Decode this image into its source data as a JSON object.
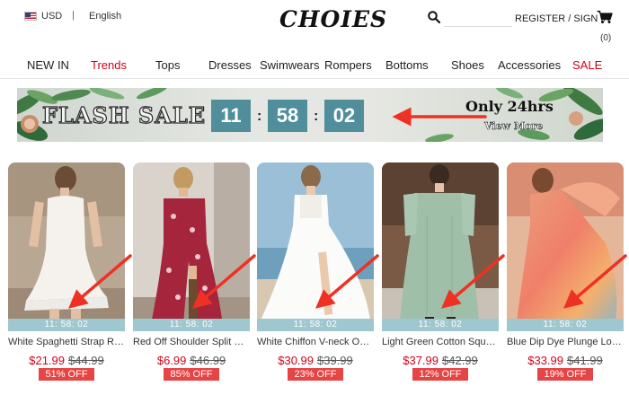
{
  "header": {
    "currency": "USD",
    "separator": "|",
    "language": "English",
    "logo": "CHOIES",
    "search": {
      "value": "",
      "placeholder": ""
    },
    "register": "REGISTER",
    "slash": "/",
    "signin": "SIGN IN",
    "cart_count": "(0)"
  },
  "nav": [
    {
      "label": "NEW IN",
      "color": "#222222"
    },
    {
      "label": "Trends",
      "color": "#d0021b"
    },
    {
      "label": "Tops",
      "color": "#222222"
    },
    {
      "label": "Dresses",
      "color": "#222222"
    },
    {
      "label": "Swimwears",
      "color": "#222222"
    },
    {
      "label": "Rompers",
      "color": "#222222"
    },
    {
      "label": "Bottoms",
      "color": "#222222"
    },
    {
      "label": "Shoes",
      "color": "#222222"
    },
    {
      "label": "Accessories",
      "color": "#222222"
    },
    {
      "label": "SALE",
      "color": "#d0021b"
    }
  ],
  "banner": {
    "title": "FLASH SALE",
    "hours": "11",
    "minutes": "58",
    "seconds": "02",
    "colon": ":",
    "tagline": "Only 24hrs",
    "cta": "View More",
    "box_color": "#4f8e9a"
  },
  "products": [
    {
      "name": "White Spaghetti Strap Ruffle Hem Bodycon Dress",
      "timer": "11: 58: 02",
      "price": "$21.99",
      "old_price": "$44.99",
      "discount": "51% OFF"
    },
    {
      "name": "Red Off Shoulder Split Side Floral Maxi Dress",
      "timer": "11: 58: 02",
      "price": "$6.99",
      "old_price": "$46.99",
      "discount": "85% OFF"
    },
    {
      "name": "White Chiffon V-neck Open Back Maxi Dress",
      "timer": "11: 58: 02",
      "price": "$30.99",
      "old_price": "$39.99",
      "discount": "23% OFF"
    },
    {
      "name": "Light Green Cotton Square Neck Maxi Dress",
      "timer": "11: 58: 02",
      "price": "$37.99",
      "old_price": "$42.99",
      "discount": "12% OFF"
    },
    {
      "name": "Blue Dip Dye Plunge Long Sleeve Maxi Dress",
      "timer": "11: 58: 02",
      "price": "$33.99",
      "old_price": "$41.99",
      "discount": "19% OFF"
    }
  ],
  "colors": {
    "accent_red": "#d0021b",
    "timer_strip": "#9ec7d0",
    "discount_badge": "#e64545",
    "arrow": "#ee3124"
  }
}
